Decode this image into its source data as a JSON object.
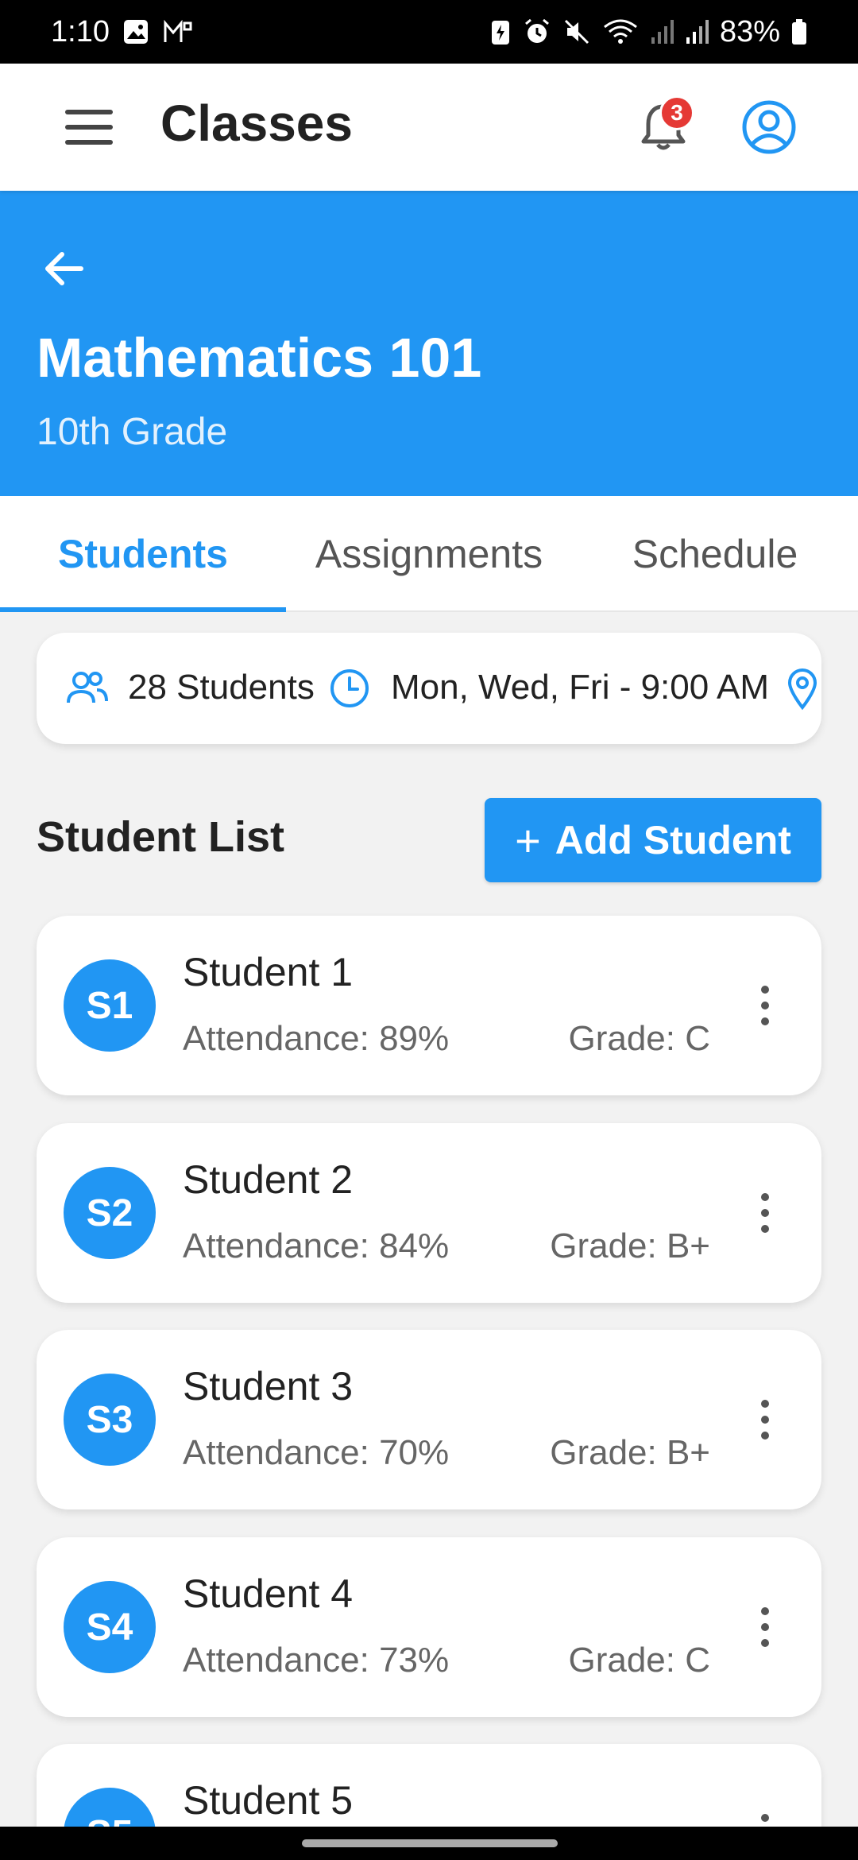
{
  "status_bar": {
    "time": "1:10",
    "battery": "83%"
  },
  "app_bar": {
    "title": "Classes",
    "notification_count": "3"
  },
  "class": {
    "name": "Mathematics 101",
    "grade_level": "10th Grade"
  },
  "tabs": [
    {
      "label": "Students",
      "active": true
    },
    {
      "label": "Assignments",
      "active": false
    },
    {
      "label": "Schedule",
      "active": false
    }
  ],
  "info": {
    "student_count": "28 Students",
    "schedule": "Mon, Wed, Fri - 9:00 AM"
  },
  "student_list": {
    "title": "Student List",
    "add_button_label": "Add Student"
  },
  "students": [
    {
      "initials": "S1",
      "name": "Student 1",
      "attendance": "Attendance: 89%",
      "grade": "Grade: C"
    },
    {
      "initials": "S2",
      "name": "Student 2",
      "attendance": "Attendance: 84%",
      "grade": "Grade: B+"
    },
    {
      "initials": "S3",
      "name": "Student 3",
      "attendance": "Attendance: 70%",
      "grade": "Grade: B+"
    },
    {
      "initials": "S4",
      "name": "Student 4",
      "attendance": "Attendance: 73%",
      "grade": "Grade: C"
    },
    {
      "initials": "S5",
      "name": "Student 5",
      "attendance": "",
      "grade": ""
    }
  ],
  "colors": {
    "primary": "#2196f3",
    "badge": "#e53935"
  }
}
